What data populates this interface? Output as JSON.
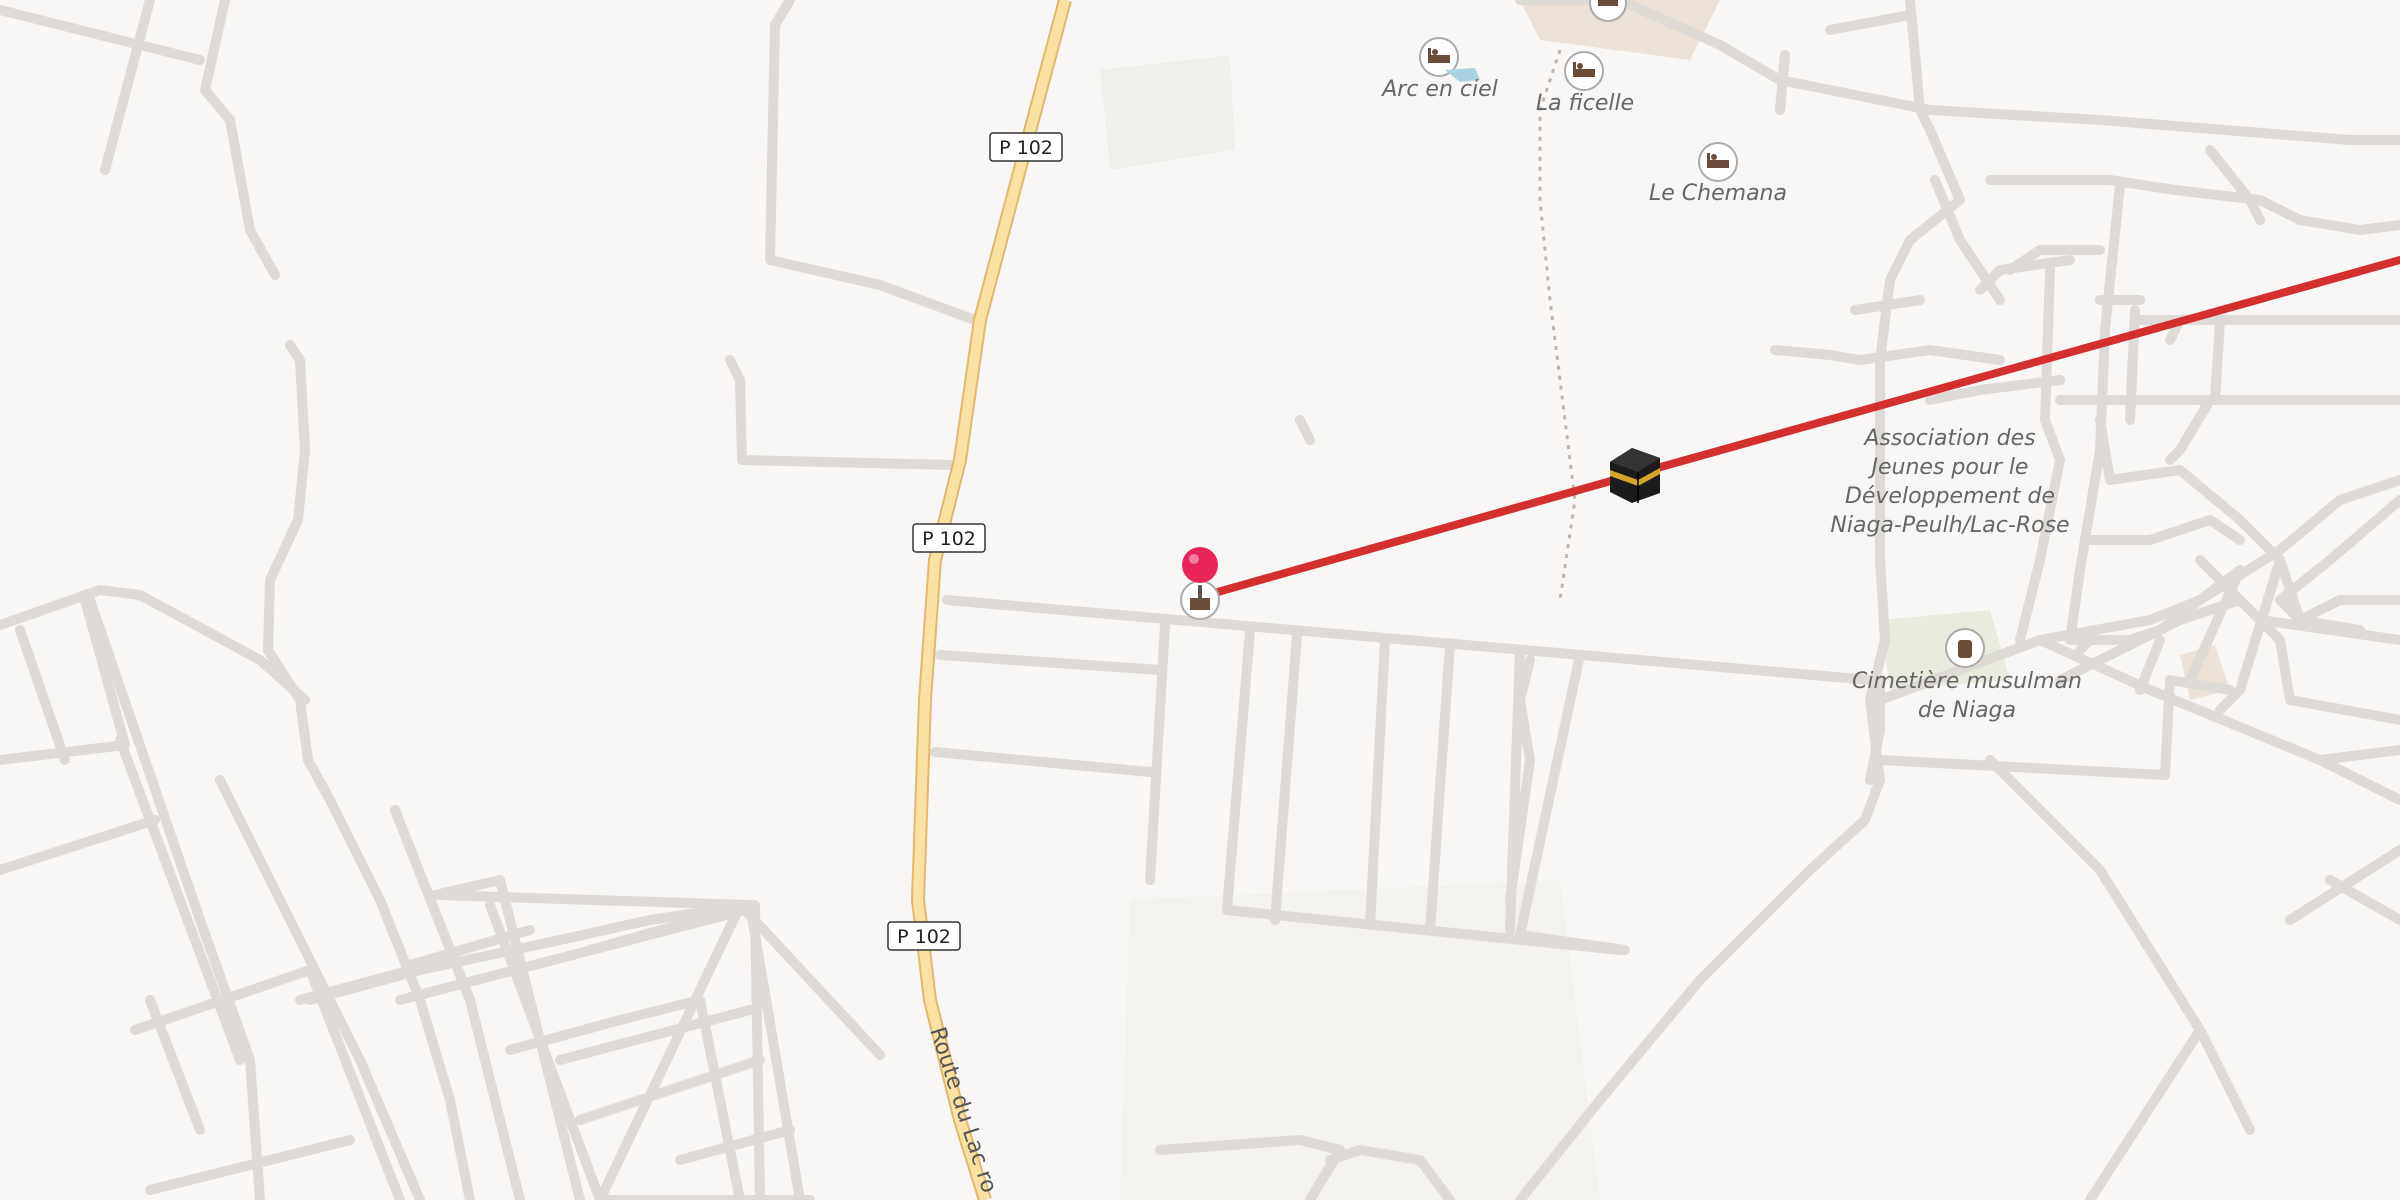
{
  "map": {
    "route_line_color": "#d32f2f",
    "marker_color": "#e8245a",
    "road_shields": [
      "P 102",
      "P 102",
      "P 102"
    ],
    "road_name": "Route du Lac ro",
    "pois": [
      {
        "name": "Arc en ciel",
        "icon": "hotel-icon"
      },
      {
        "name": "La ficelle",
        "icon": "hotel-icon"
      },
      {
        "name": "Le Chemana",
        "icon": "hotel-icon"
      },
      {
        "name_lines": [
          "Association des",
          "Jeunes pour le",
          "Développement de",
          "Niaga-Peulh/Lac-Rose"
        ],
        "icon": "none"
      },
      {
        "name_lines": [
          "Cimetière musulman",
          "de Niaga"
        ],
        "icon": "cemetery-icon"
      }
    ],
    "start_poi_icon": "mosque-icon",
    "destination_icon": "kaaba-icon"
  }
}
